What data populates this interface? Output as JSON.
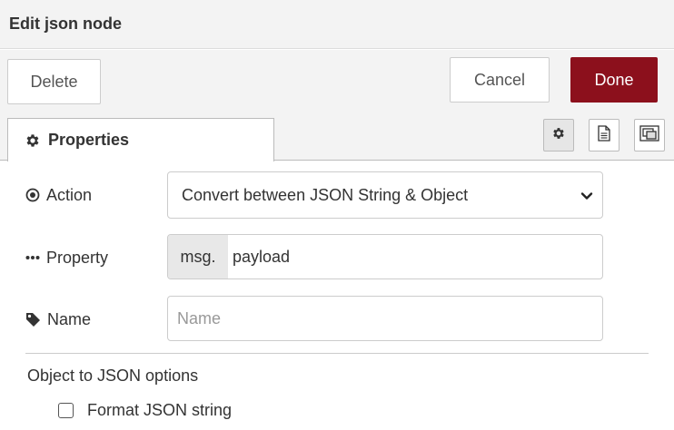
{
  "header": {
    "title": "Edit json node"
  },
  "toolbar": {
    "delete_label": "Delete",
    "cancel_label": "Cancel",
    "done_label": "Done"
  },
  "tabs": {
    "properties_label": "Properties",
    "icons": [
      "gear-icon",
      "description-icon",
      "appearance-icon"
    ]
  },
  "form": {
    "action": {
      "label": "Action",
      "selected": "Convert between JSON String & Object",
      "icon": "dot-circle-icon"
    },
    "property": {
      "label": "Property",
      "prefix": "msg.",
      "value": "payload",
      "icon": "ellipsis-icon"
    },
    "name": {
      "label": "Name",
      "placeholder": "Name",
      "value": "",
      "icon": "tag-icon"
    },
    "options": {
      "section_title": "Object to JSON options",
      "format_label": "Format JSON string",
      "format_checked": false
    }
  },
  "colors": {
    "done_bg": "#8c101c",
    "header_bg": "#f3f3f3",
    "border": "#cccccc"
  }
}
